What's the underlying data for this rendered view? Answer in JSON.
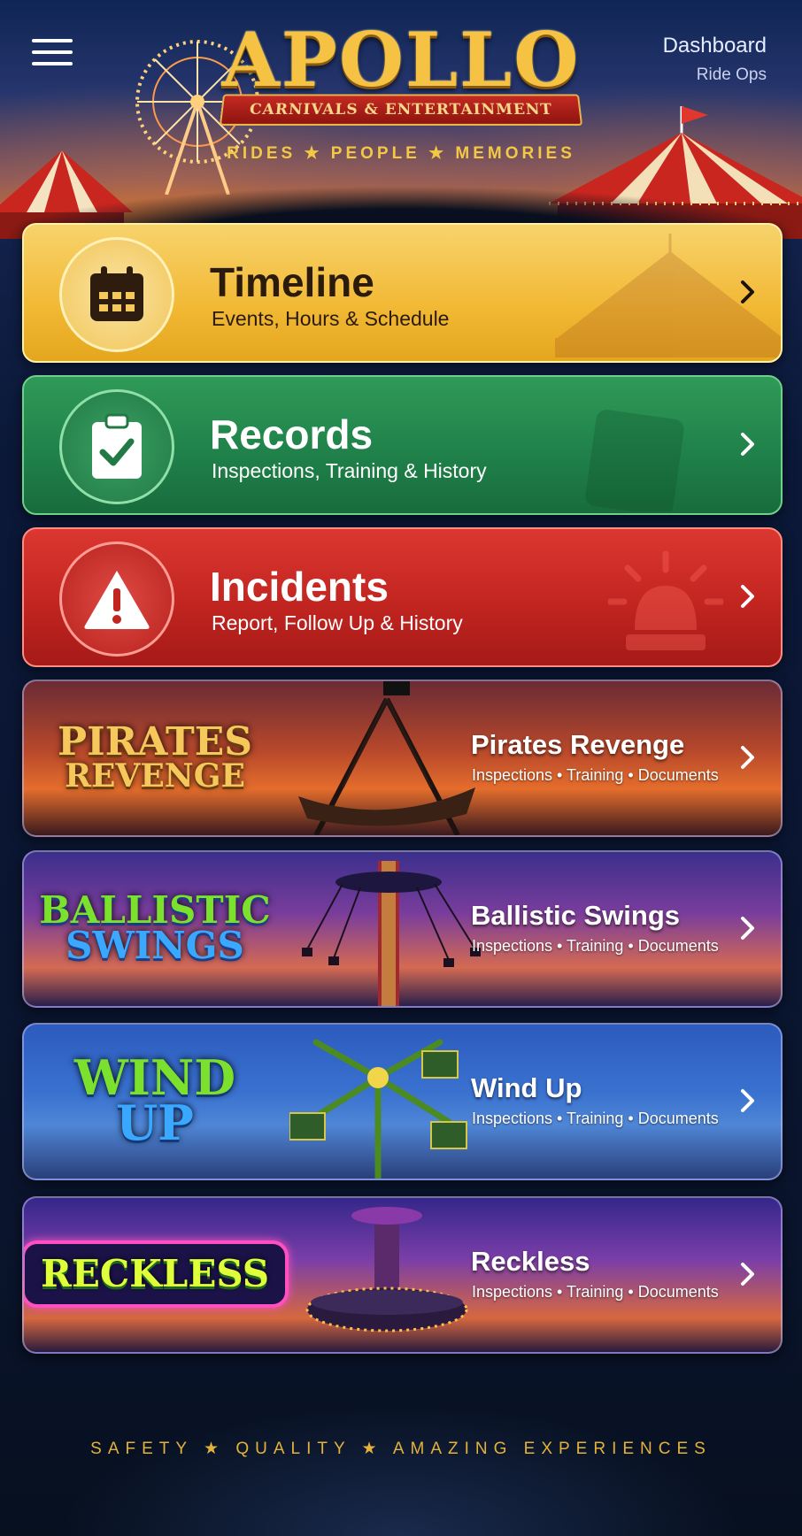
{
  "header": {
    "logo": "APOLLO",
    "logo_ribbon": "CARNIVALS & ENTERTAINMENT",
    "tagline": "RIDES ★ PEOPLE ★ MEMORIES",
    "dashboard_title": "Dashboard",
    "dashboard_sub": "Ride Ops",
    "menu_icon": "hamburger-menu-icon"
  },
  "nav": [
    {
      "title": "Timeline",
      "subtitle": "Events, Hours & Schedule",
      "icon": "calendar-icon",
      "color": "#f2b935"
    },
    {
      "title": "Records",
      "subtitle": "Inspections, Training & History",
      "icon": "clipboard-check-icon",
      "color": "#20824a"
    },
    {
      "title": "Incidents",
      "subtitle": "Report, Follow Up & History",
      "icon": "warning-triangle-icon",
      "color": "#c22520"
    }
  ],
  "rides": [
    {
      "name": "Pirates Revenge",
      "details": "Inspections • Training • Documents",
      "badge": [
        "PIRATES",
        "REVENGE"
      ]
    },
    {
      "name": "Ballistic Swings",
      "details": "Inspections • Training • Documents",
      "badge": [
        "BALLISTIC",
        "SWINGS"
      ]
    },
    {
      "name": "Wind Up",
      "details": "Inspections • Training • Documents",
      "badge": [
        "WIND",
        "UP"
      ]
    },
    {
      "name": "Reckless",
      "details": "Inspections • Training • Documents",
      "badge": [
        "RECKLESS"
      ]
    }
  ],
  "footer": {
    "text": "SAFETY ★ QUALITY ★ AMAZING EXPERIENCES"
  }
}
